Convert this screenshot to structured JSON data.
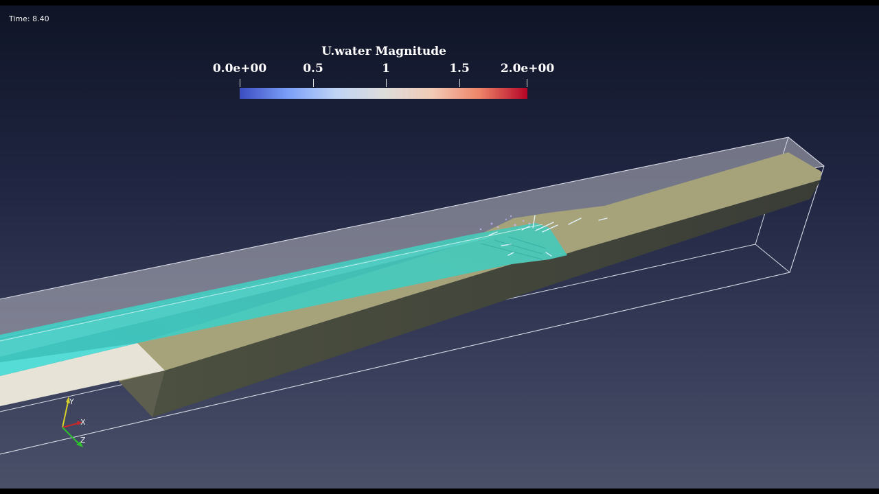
{
  "time_label": "Time: 8.40",
  "scalar_bar": {
    "title": "U.water Magnitude",
    "labels": [
      "0.0e+00",
      "0.5",
      "1",
      "1.5",
      "2.0e+00"
    ],
    "colormap": [
      "#3b4cc0",
      "#7b9ff9",
      "#c0d4f5",
      "#dddcdc",
      "#f2cbb7",
      "#ee8468",
      "#b40426"
    ]
  },
  "orientation_axes": {
    "x": "X",
    "y": "Y",
    "z": "Z"
  },
  "colors": {
    "water": "#44cfc6",
    "sediment_top": "#a8a47a",
    "sediment_side": "#4d5040",
    "inflow_floor": "#e6e2d6",
    "outline": "#d8dae6"
  }
}
